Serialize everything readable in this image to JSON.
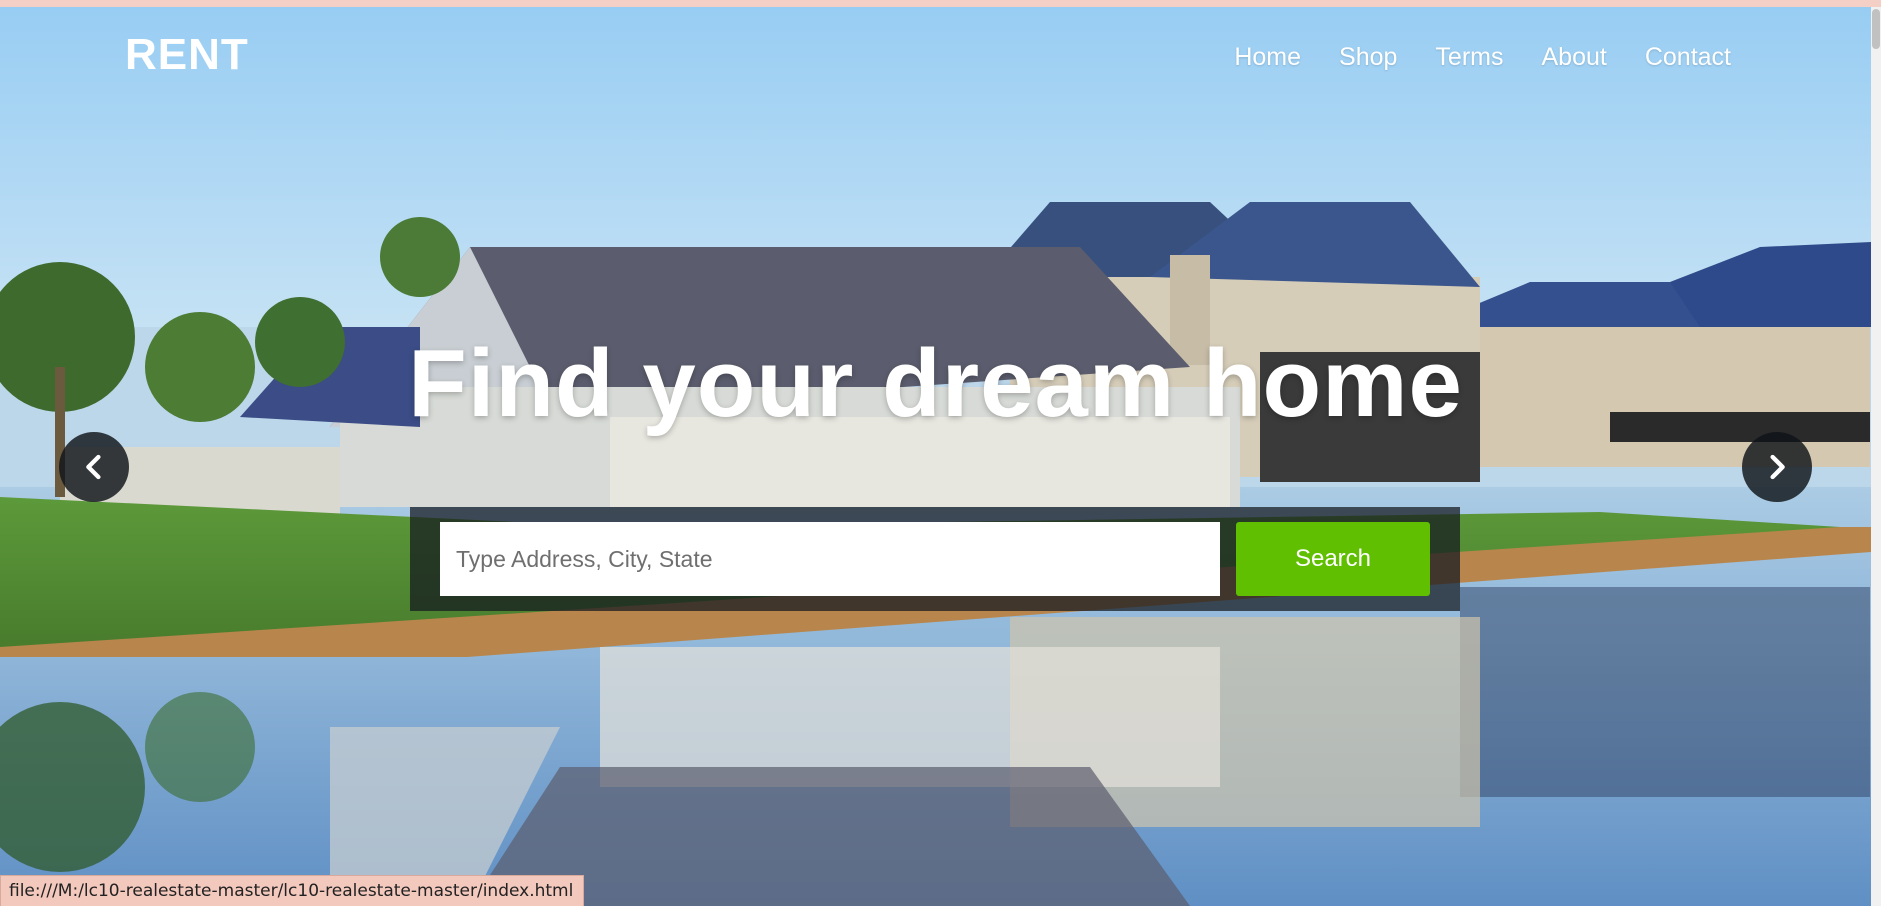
{
  "brand": {
    "logo": "RENT"
  },
  "nav": {
    "items": [
      {
        "label": "Home"
      },
      {
        "label": "Shop"
      },
      {
        "label": "Terms"
      },
      {
        "label": "About"
      },
      {
        "label": "Contact"
      }
    ]
  },
  "hero": {
    "headline": "Find your dream home",
    "search": {
      "placeholder": "Type Address, City, State",
      "value": "",
      "button_label": "Search"
    },
    "carousel": {
      "prev_icon": "chevron-left-icon",
      "next_icon": "chevron-right-icon"
    },
    "image_description_icon": "hero-photo"
  },
  "status_bar": {
    "url": "file:///M:/lc10-realestate-master/lc10-realestate-master/index.html"
  },
  "colors": {
    "search_button": "#5fbf00",
    "search_panel": "#14181e",
    "text_on_hero": "#ffffff",
    "status_bar": "#f3c8bd"
  }
}
